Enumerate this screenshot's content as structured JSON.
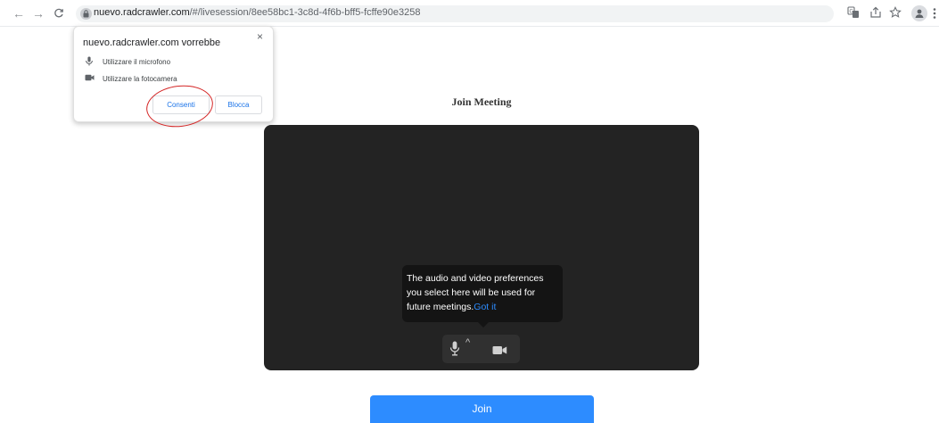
{
  "browser": {
    "url_host": "nuevo.radcrawler.com",
    "url_path": "/#/livesession/8ee58bc1-3c8d-4f6b-bff5-fcffe90e3258"
  },
  "permission_popup": {
    "title": "nuevo.radcrawler.com vorrebbe",
    "items": [
      {
        "icon": "microphone-icon",
        "label": "Utilizzare il microfono"
      },
      {
        "icon": "camera-icon",
        "label": "Utilizzare la fotocamera"
      }
    ],
    "allow_label": "Consenti",
    "block_label": "Blocca",
    "close_glyph": "×"
  },
  "meeting": {
    "title": "Join Meeting",
    "tooltip_text": "The audio and video preferences you select here will be used for future meetings.",
    "tooltip_link": "Got it",
    "join_label": "Join"
  },
  "colors": {
    "accent": "#2d8cff",
    "preview_bg": "#232323",
    "annotation": "#d42525"
  }
}
